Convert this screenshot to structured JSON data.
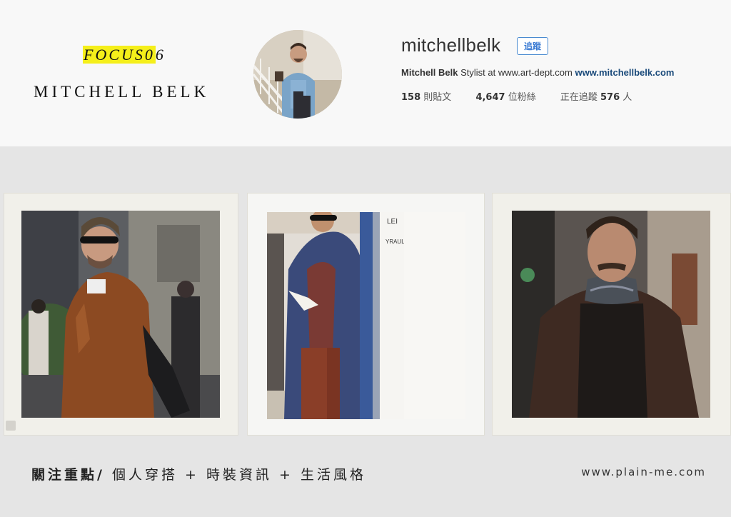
{
  "brand": {
    "focus_highlight": "FOCUS0",
    "focus_rest": "6",
    "name": "MITCHELL BELK"
  },
  "profile": {
    "avatar_icon": "profile-avatar",
    "username": "mitchellbelk",
    "follow_label": "追蹤",
    "bio_name": "Mitchell Belk",
    "bio_text": "Stylist at www.art-dept.com",
    "bio_link": "www.mitchellbelk.com",
    "stats": {
      "posts_count": "158",
      "posts_label": "則貼文",
      "followers_count": "4,647",
      "followers_label": "位粉絲",
      "following_prefix": "正在追蹤",
      "following_count": "576",
      "following_suffix": "人"
    }
  },
  "posts": [
    {
      "subject": "man-in-tan-suede-jacket"
    },
    {
      "subject": "man-in-navy-coat-reading"
    },
    {
      "subject": "man-in-brown-coat-scarf"
    }
  ],
  "footer": {
    "headline_strong": "關注重點/",
    "headline_rest": " 個人穿搭 + 時裝資訊 + 生活風格",
    "website": "www.plain-me.com"
  },
  "colors": {
    "highlight": "#f5ef1a",
    "follow_button": "#3b7bd3",
    "header_bg": "#f8f8f8",
    "page_bg": "#e5e5e5"
  }
}
